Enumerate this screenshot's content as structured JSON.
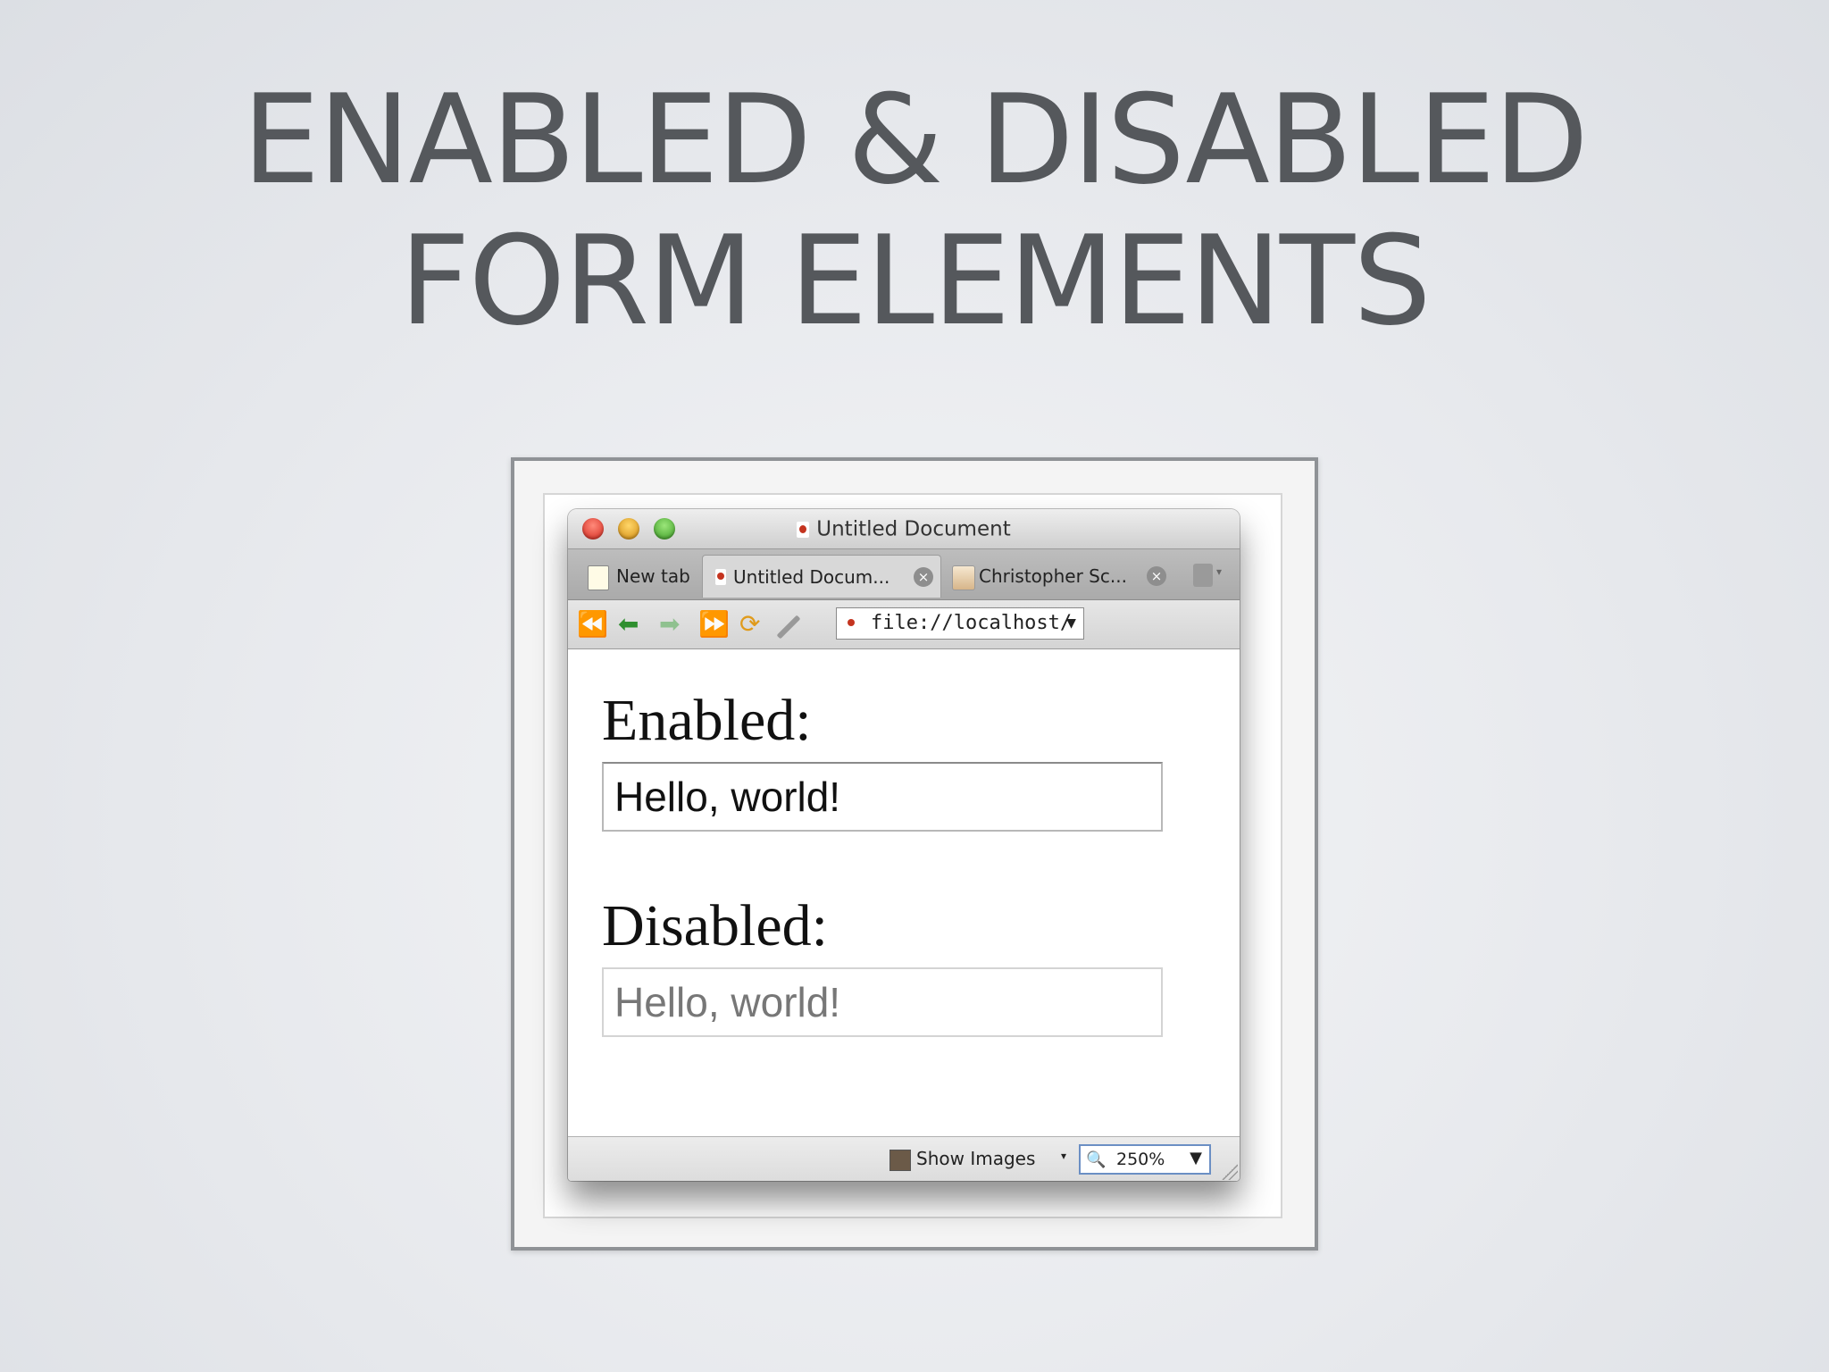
{
  "slide": {
    "title_line1": "ENABLED & DISABLED",
    "title_line2": "FORM ELEMENTS"
  },
  "window": {
    "title": "Untitled Document",
    "tabs": [
      {
        "label": "New tab",
        "icon": "new-tab-icon"
      },
      {
        "label": "Untitled Docum...",
        "icon": "page-icon",
        "active": true
      },
      {
        "label": "Christopher Sc...",
        "icon": "avatar-icon"
      }
    ],
    "toolbar": {
      "rewind_glyph": "⏪",
      "back_glyph": "⬅",
      "forward_glyph": "➡",
      "fastforward_glyph": "⏩",
      "reload_glyph": "⟳",
      "url": "file://localhost/",
      "url_dropdown": "▼"
    },
    "content": {
      "enabled_label": "Enabled:",
      "enabled_value": "Hello, world!",
      "disabled_label": "Disabled:",
      "disabled_value": "Hello, world!"
    },
    "statusbar": {
      "show_images": "Show Images",
      "dropdown_caret": "▾",
      "zoom": "250%",
      "zoom_icon": "🔍",
      "zoom_dropdown": "▼"
    },
    "close_glyph": "×"
  },
  "colors": {
    "title_text": "#55585c",
    "close": "#d2261c",
    "minimize": "#d18a0e",
    "zoom": "#3a9a23"
  }
}
